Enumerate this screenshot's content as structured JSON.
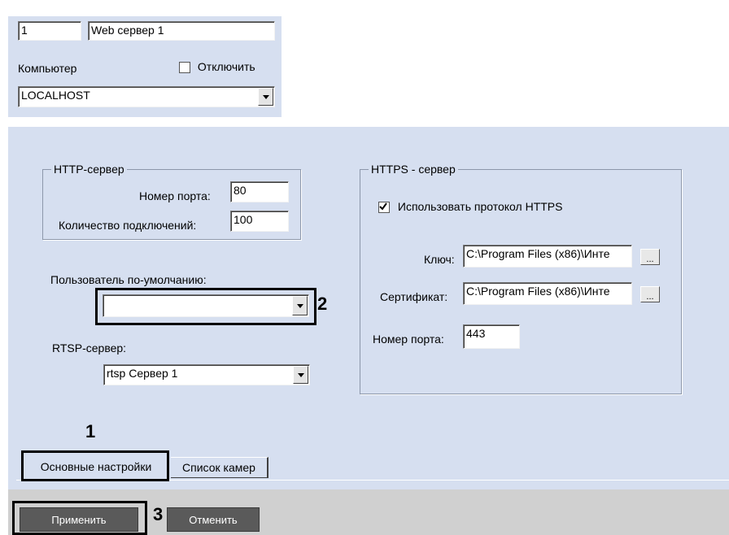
{
  "header": {
    "id_value": "1",
    "name_value": "Web сервер 1",
    "computer_label": "Компьютер",
    "disable_label": "Отключить",
    "computer_value": "LOCALHOST"
  },
  "http": {
    "legend": "HTTP-сервер",
    "port_label": "Номер порта:",
    "port_value": "80",
    "connections_label": "Количество подключений:",
    "connections_value": "100"
  },
  "default_user": {
    "label": "Пользователь по-умолчанию:",
    "value": ""
  },
  "rtsp": {
    "label": "RTSP-сервер:",
    "value": "rtsp Сервер 1"
  },
  "https": {
    "legend": "HTTPS - сервер",
    "use_label": "Использовать протокол HTTPS",
    "use_checked": true,
    "key_label": "Ключ:",
    "key_value": "C:\\Program Files (x86)\\Инте",
    "cert_label": "Сертификат:",
    "cert_value": "C:\\Program Files (x86)\\Инте",
    "browse_label": "...",
    "port_label": "Номер порта:",
    "port_value": "443"
  },
  "tabs": [
    {
      "label": "Основные настройки"
    },
    {
      "label": "Список камер"
    }
  ],
  "buttons": {
    "apply": "Применить",
    "cancel": "Отменить"
  },
  "callouts": {
    "one": "1",
    "two": "2",
    "three": "3"
  },
  "colors": {
    "panel": "#d6dff0",
    "button": "#5a5a5a"
  }
}
